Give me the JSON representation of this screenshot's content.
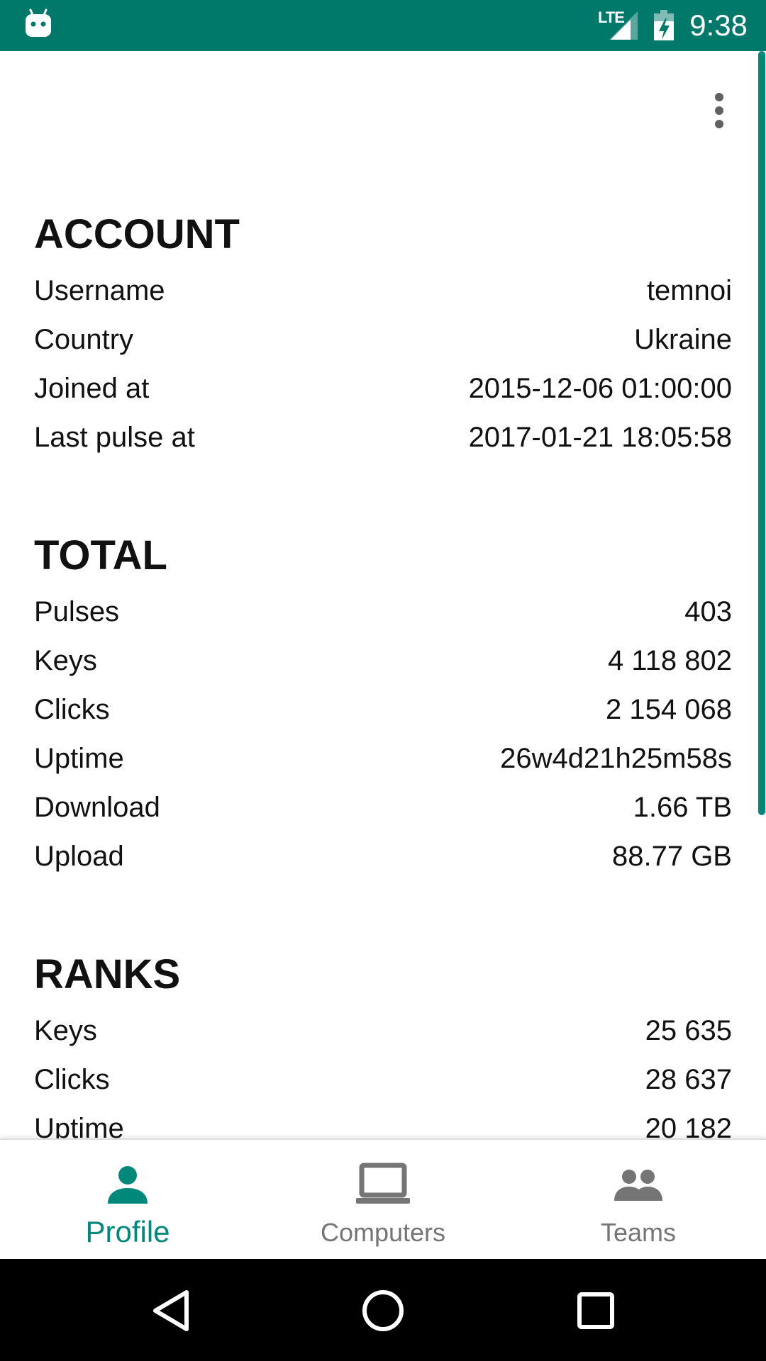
{
  "status_bar": {
    "network_label": "LTE",
    "time": "9:38"
  },
  "account": {
    "title": "ACCOUNT",
    "rows": [
      {
        "label": "Username",
        "value": "temnoi"
      },
      {
        "label": "Country",
        "value": "Ukraine"
      },
      {
        "label": "Joined at",
        "value": "2015-12-06 01:00:00"
      },
      {
        "label": "Last pulse at",
        "value": "2017-01-21 18:05:58"
      }
    ]
  },
  "total": {
    "title": "TOTAL",
    "rows": [
      {
        "label": "Pulses",
        "value": "403"
      },
      {
        "label": "Keys",
        "value": "4 118 802"
      },
      {
        "label": "Clicks",
        "value": "2 154 068"
      },
      {
        "label": "Uptime",
        "value": "26w4d21h25m58s"
      },
      {
        "label": "Download",
        "value": "1.66 TB"
      },
      {
        "label": "Upload",
        "value": "88.77 GB"
      }
    ]
  },
  "ranks": {
    "title": "RANKS",
    "rows": [
      {
        "label": "Keys",
        "value": "25 635"
      },
      {
        "label": "Clicks",
        "value": "28 637"
      },
      {
        "label": "Uptime",
        "value": "20 182"
      }
    ]
  },
  "bottom_nav": {
    "items": [
      {
        "label": "Profile",
        "icon": "person-icon",
        "active": true
      },
      {
        "label": "Computers",
        "icon": "laptop-icon",
        "active": false
      },
      {
        "label": "Teams",
        "icon": "group-icon",
        "active": false
      }
    ]
  },
  "colors": {
    "status_bar": "#00796b",
    "accent": "#00897b",
    "inactive": "#757575",
    "text": "#111111"
  }
}
